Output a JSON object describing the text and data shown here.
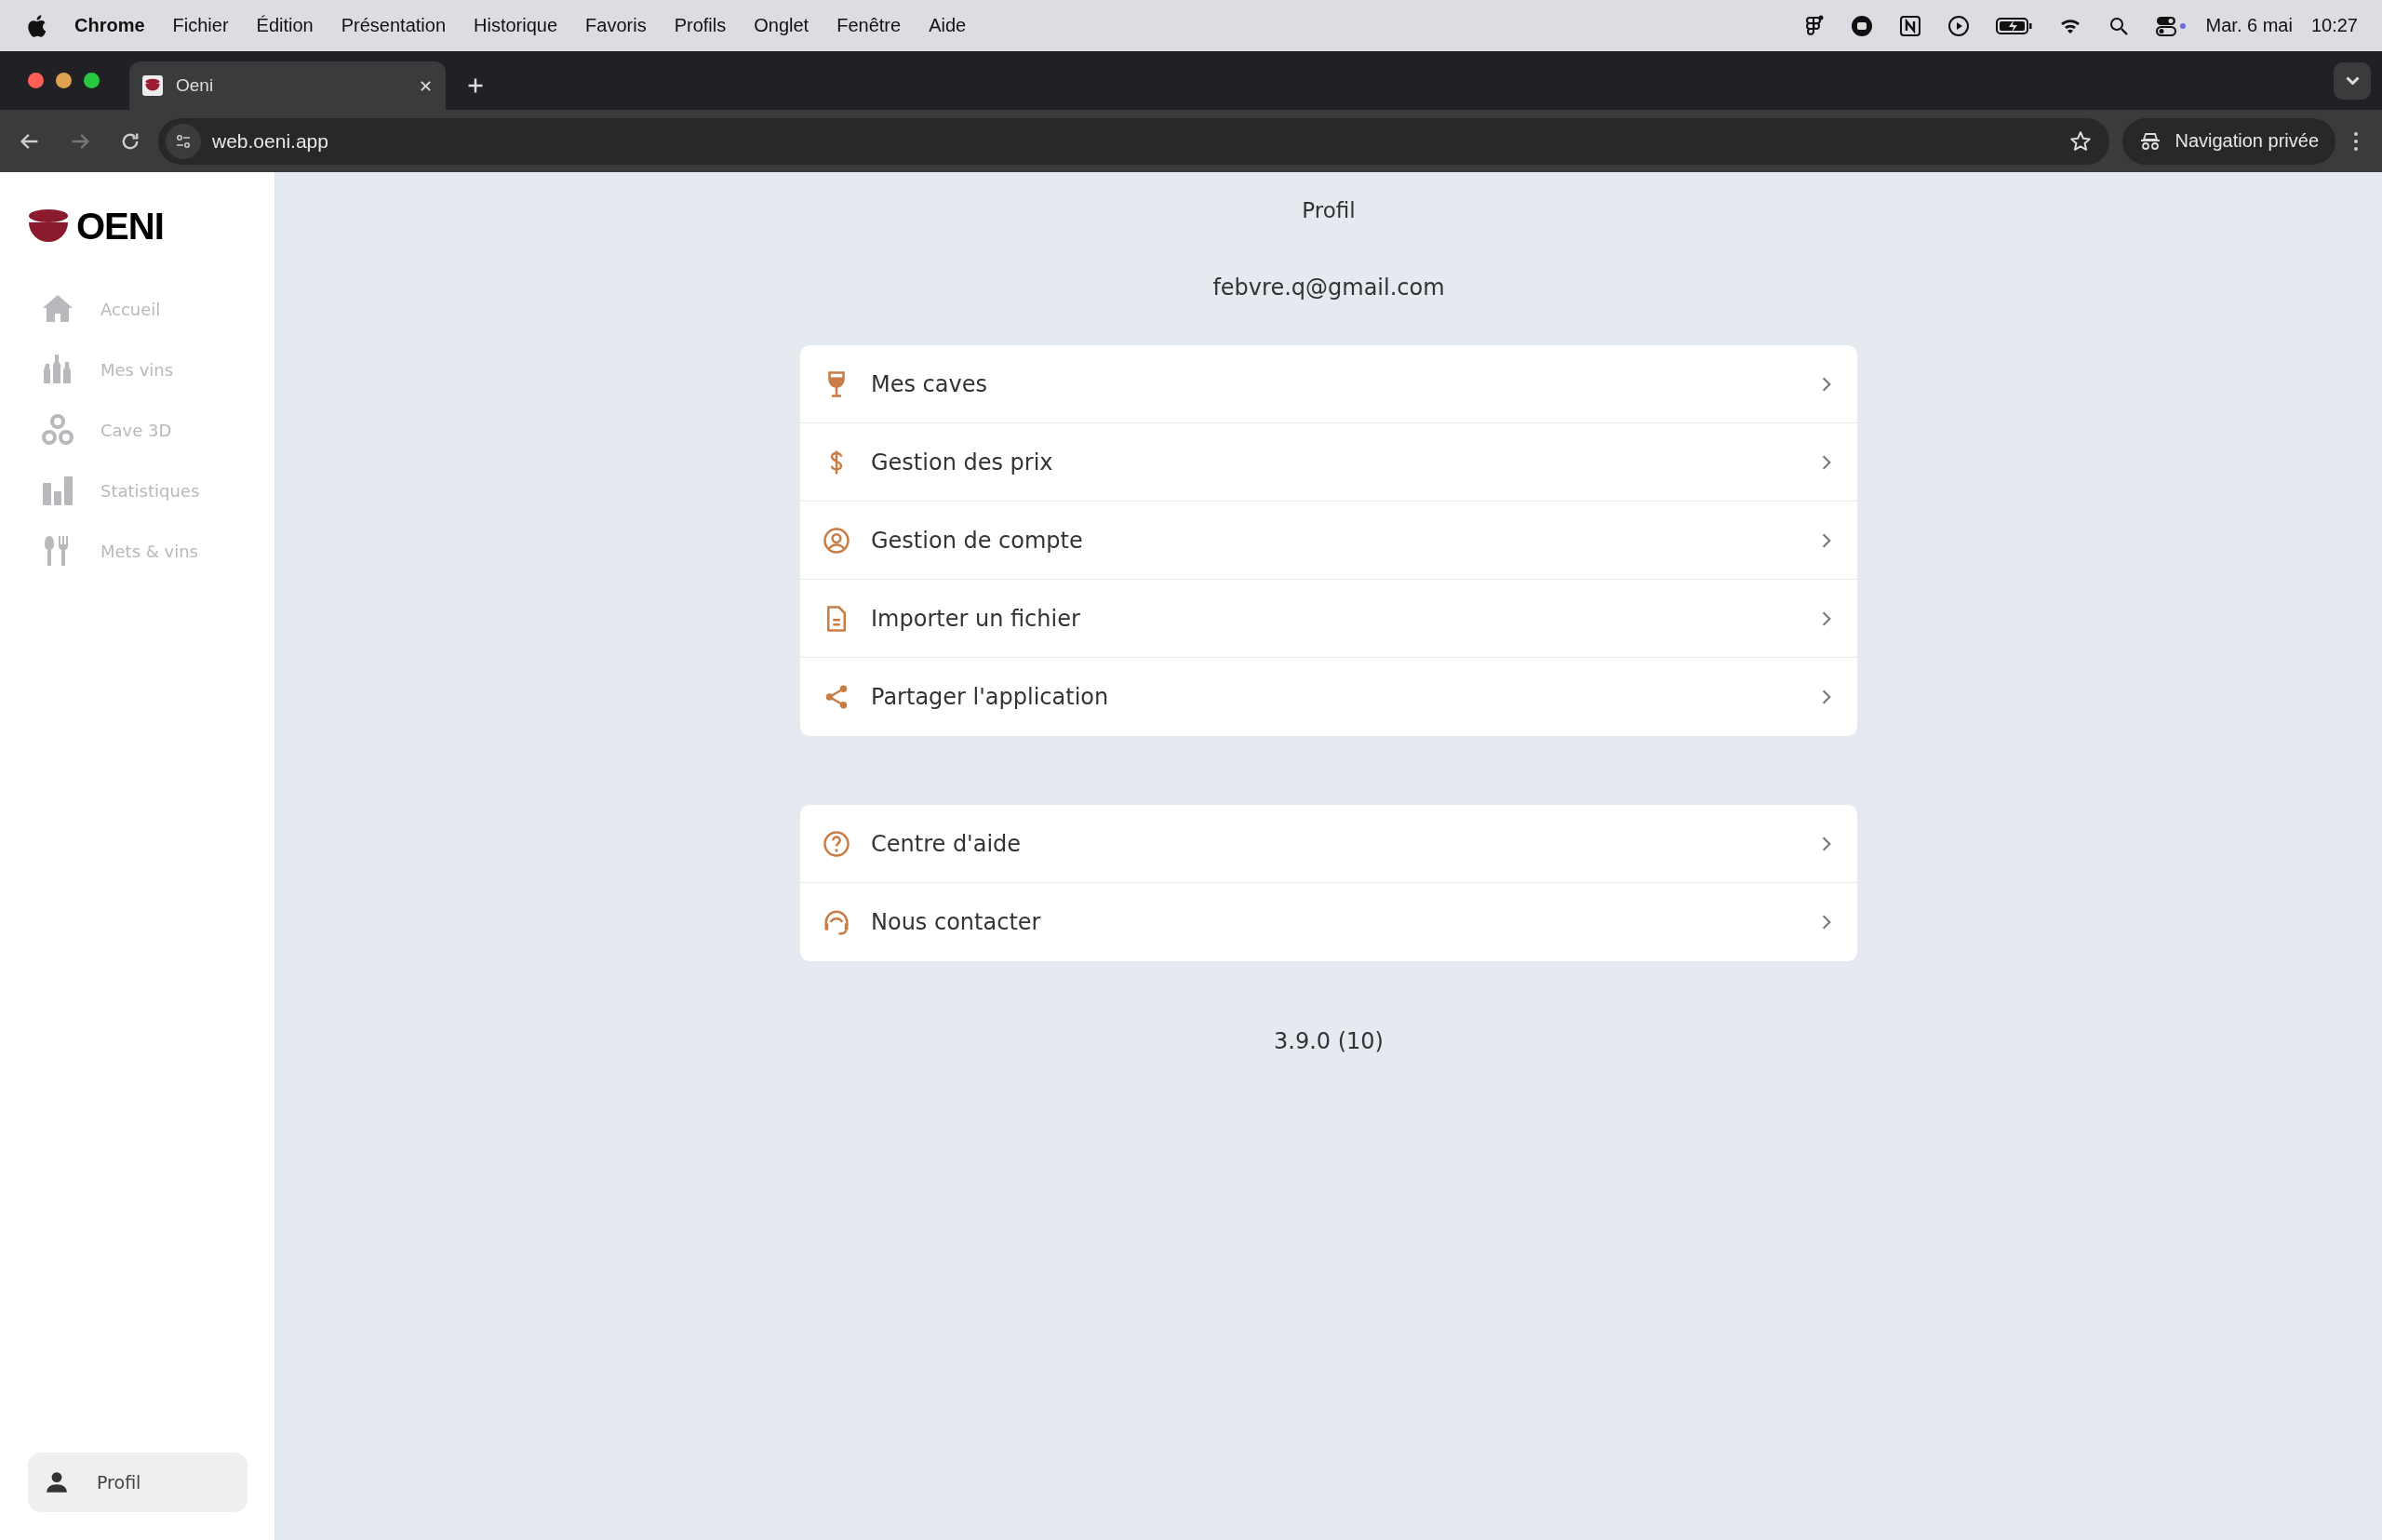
{
  "menu_bar": {
    "app": "Chrome",
    "items": [
      "Fichier",
      "Édition",
      "Présentation",
      "Historique",
      "Favoris",
      "Profils",
      "Onglet",
      "Fenêtre",
      "Aide"
    ],
    "date": "Mar. 6 mai",
    "time": "10:27"
  },
  "browser": {
    "tab": {
      "title": "Oeni",
      "selected": true
    },
    "address": "web.oeni.app",
    "private_label": "Navigation privée"
  },
  "sidebar": {
    "logo": "OENI",
    "items": [
      {
        "label": "Accueil",
        "selected": false
      },
      {
        "label": "Mes vins",
        "selected": false
      },
      {
        "label": "Cave 3D",
        "selected": false
      },
      {
        "label": "Statistiques",
        "selected": false
      },
      {
        "label": "Mets & vins",
        "selected": false
      }
    ],
    "profile": {
      "label": "Profil",
      "selected": true
    }
  },
  "page": {
    "title": "Profil",
    "email": "febvre.q@gmail.com",
    "groups": [
      [
        {
          "label": "Mes caves"
        },
        {
          "label": "Gestion des prix"
        },
        {
          "label": "Gestion de compte"
        },
        {
          "label": "Importer un fichier"
        },
        {
          "label": "Partager l'application"
        }
      ],
      [
        {
          "label": "Centre d'aide"
        },
        {
          "label": "Nous contacter"
        }
      ]
    ],
    "version": "3.9.0 (10)"
  }
}
